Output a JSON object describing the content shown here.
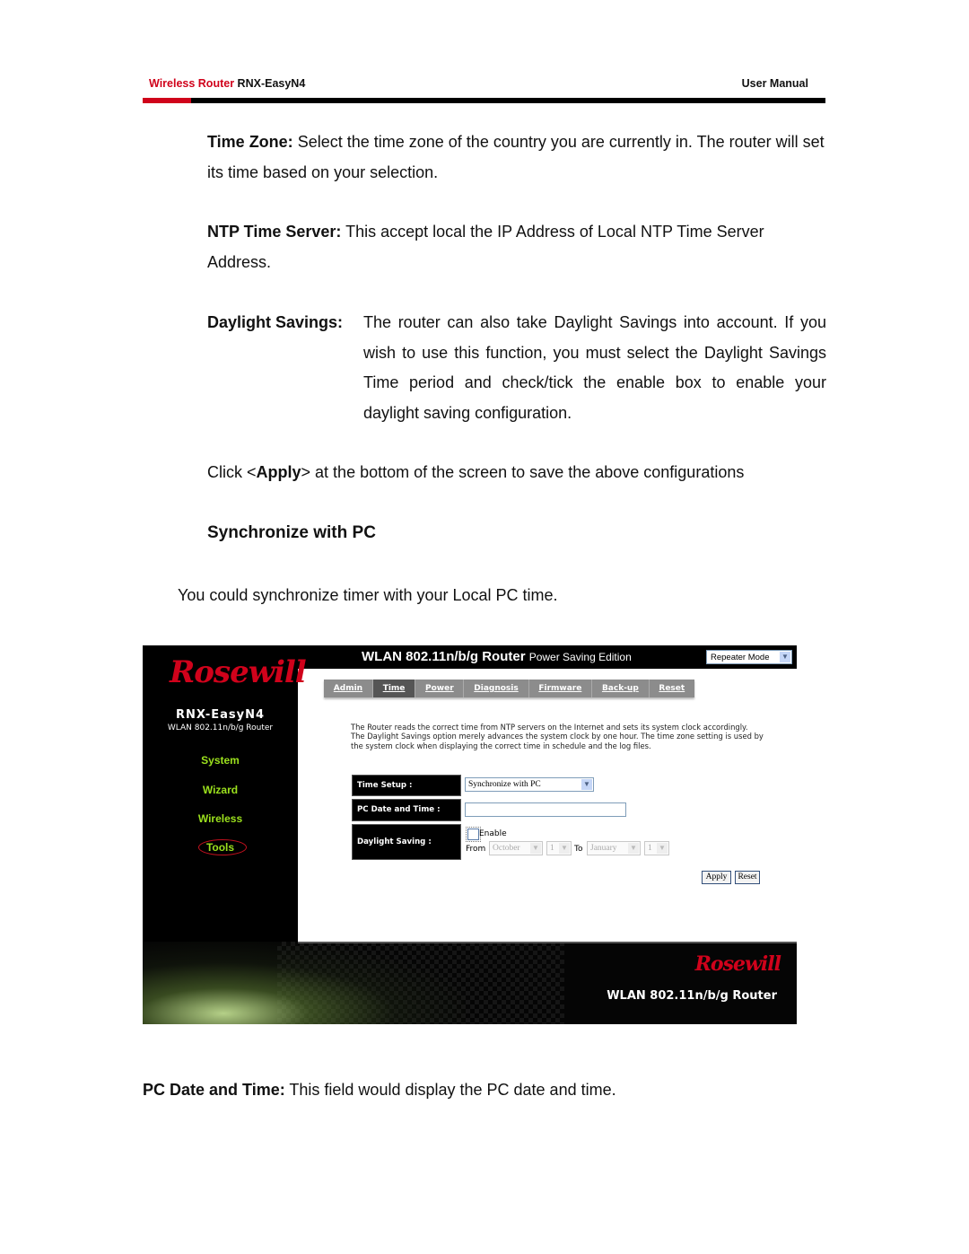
{
  "header": {
    "product_prefix": "Wireless Router",
    "product_model": "RNX-EasyN4",
    "doc_type": "User Manual",
    "accent_color": "#d0021b"
  },
  "definitions": [
    {
      "term": "Time Zone:",
      "text": "Select the time zone of the country you are currently in. The router will set its time based on your selection."
    },
    {
      "term": "NTP Time Server:",
      "text": "This accept local the IP Address of Local NTP Time Server Address."
    },
    {
      "term": "Daylight Savings:",
      "text": "The router can also take Daylight Savings into account. If you wish to use this function, you must select the Daylight Savings Time period and check/tick the enable box to enable your daylight saving configuration."
    }
  ],
  "apply_note": {
    "before": "Click <",
    "bold": "Apply",
    "after": "> at the bottom of the screen to save the above configurations"
  },
  "section": {
    "title": "Synchronize with PC",
    "intro": "You could synchronize timer with your Local PC time."
  },
  "router_ui": {
    "brand_logo": "Rosewill",
    "title_main": "WLAN 802.11n/b/g Router",
    "title_sub": "Power Saving Edition",
    "mode_select": "Repeater Mode",
    "model": "RNX-EasyN4",
    "model_sub": "WLAN 802.11n/b/g Router",
    "nav": [
      "System",
      "Wizard",
      "Wireless",
      "Tools"
    ],
    "nav_active": "Tools",
    "tabs": [
      "Admin",
      "Time",
      "Power",
      "Diagnosis",
      "Firmware",
      "Back-up",
      "Reset"
    ],
    "tab_active": "Time",
    "description": "The Router reads the correct time from NTP servers on the Internet and sets its system clock accordingly. The Daylight Savings option merely advances the system clock by one hour. The time zone setting is used by the system clock when displaying the correct time in schedule and the log files.",
    "form": {
      "time_setup_label": "Time Setup :",
      "time_setup_value": "Synchronize with PC",
      "pc_date_label": "PC Date and Time :",
      "pc_date_value": "",
      "daylight_label": "Daylight Saving :",
      "enable_label": "Enable",
      "enable_checked": false,
      "from_label": "From",
      "from_month": "October",
      "from_day": "1",
      "to_label": "To",
      "to_month": "January",
      "to_day": "1"
    },
    "apply_button": "Apply",
    "reset_button": "Reset",
    "footer_logo": "Rosewill",
    "footer_title": "WLAN 802.11n/b/g Router",
    "nav_color": "#9be01d"
  },
  "pc_date_desc": {
    "term": "PC Date and Time:",
    "text": "This field would display the PC date and time."
  }
}
